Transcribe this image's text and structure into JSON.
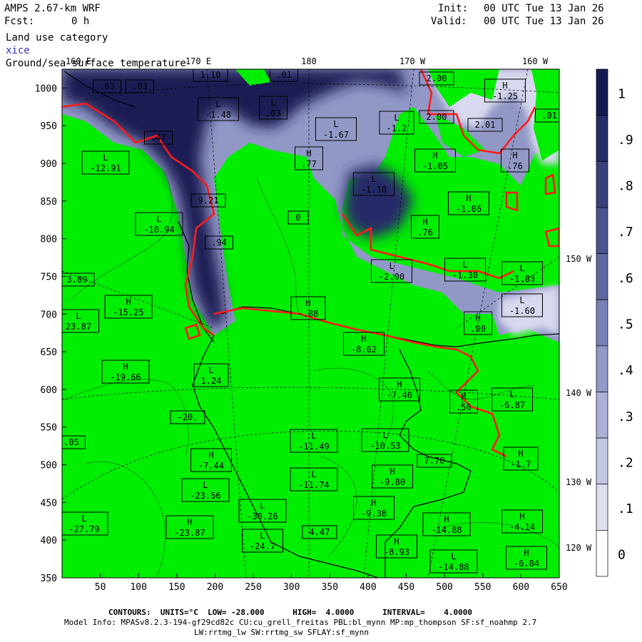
{
  "header": {
    "model_title": "AMPS 2.67-km WRF",
    "forecast_label": "Fcst:",
    "forecast_hour": "0 h",
    "init_label": "Init:",
    "init_time": "00 UTC Tue 13 Jan 26",
    "valid_label": "Valid:",
    "valid_time": "00 UTC Tue 13 Jan 26",
    "field_1": "Land use category",
    "field_2": "xice",
    "field_3": "Ground/sea surface temperature"
  },
  "map": {
    "x_ticks": [
      "50",
      "100",
      "150",
      "200",
      "250",
      "300",
      "350",
      "400",
      "450",
      "500",
      "550",
      "600",
      "650"
    ],
    "y_ticks": [
      "1000",
      "950",
      "900",
      "850",
      "800",
      "750",
      "700",
      "650",
      "600",
      "550",
      "500",
      "450",
      "400",
      "350"
    ],
    "lon_labels_top": [
      "160 E",
      "170 E",
      "180",
      "170 W",
      "160 W"
    ],
    "lon_labels_right": [
      "150 W",
      "140 W",
      "130 W",
      "120 W"
    ],
    "colors": {
      "land": "#00ee00",
      "ice_dark": "#1a1f55",
      "ice_light": "#d8d8ee",
      "coast": "#000000",
      "ice_edge": "#ff0000"
    }
  },
  "temperature_labels": [
    {
      "t": "",
      "v": ".03"
    },
    {
      "t": "",
      "v": ".03"
    },
    {
      "t": "",
      "v": "1.10"
    },
    {
      "t": "",
      "v": ".01"
    },
    {
      "t": "",
      "v": "2.00"
    },
    {
      "t": "H",
      "v": "-1.25"
    },
    {
      "t": "",
      "v": ".01"
    },
    {
      "t": "L",
      "v": "-1.48"
    },
    {
      "t": "L",
      "v": ".03"
    },
    {
      "t": "L",
      "v": "-1.67"
    },
    {
      "t": "L",
      "v": "-1.2"
    },
    {
      "t": "",
      "v": "2.00"
    },
    {
      "t": "",
      "v": "2.01"
    },
    {
      "t": "",
      "v": ".47"
    },
    {
      "t": "L",
      "v": "-12.91"
    },
    {
      "t": "H",
      "v": ".77"
    },
    {
      "t": "H",
      "v": "-1.05"
    },
    {
      "t": "H",
      "v": ".76"
    },
    {
      "t": "L",
      "v": "-1.10"
    },
    {
      "t": "H",
      "v": "-1.06"
    },
    {
      "t": "",
      "v": "9.21"
    },
    {
      "t": "L",
      "v": "-18.94"
    },
    {
      "t": "",
      "v": ".94"
    },
    {
      "t": "",
      "v": "0"
    },
    {
      "t": "H",
      "v": ".76"
    },
    {
      "t": "L",
      "v": "-1.30"
    },
    {
      "t": "L",
      "v": "-1.83"
    },
    {
      "t": "L",
      "v": "-2.00"
    },
    {
      "t": "",
      "v": "3.89"
    },
    {
      "t": "H",
      "v": "-15.25"
    },
    {
      "t": "H",
      "v": "-.88"
    },
    {
      "t": "L",
      "v": "-1.60"
    },
    {
      "t": "L",
      "v": "23.87"
    },
    {
      "t": "H",
      "v": "-8.62"
    },
    {
      "t": "H",
      "v": ".90"
    },
    {
      "t": "H",
      "v": "-19.66"
    },
    {
      "t": "L",
      "v": "1.24"
    },
    {
      "t": "H",
      "v": "-7.40"
    },
    {
      "t": "H",
      "v": ".56"
    },
    {
      "t": "L",
      "v": "-6.87"
    },
    {
      "t": "",
      "v": "-20."
    },
    {
      "t": "",
      "v": ".05"
    },
    {
      "t": "L",
      "v": "-11.49"
    },
    {
      "t": "L",
      "v": "-10.53"
    },
    {
      "t": "H",
      "v": "-7.44"
    },
    {
      "t": "L",
      "v": "-11.74"
    },
    {
      "t": "H",
      "v": "-9.80"
    },
    {
      "t": "",
      "v": "7.70"
    },
    {
      "t": "H",
      "v": "-1.7"
    },
    {
      "t": "L",
      "v": "-23.56"
    },
    {
      "t": "L",
      "v": "-30.26"
    },
    {
      "t": "H",
      "v": "-9.38"
    },
    {
      "t": "L",
      "v": "-27.79"
    },
    {
      "t": "H",
      "v": "-23.87"
    },
    {
      "t": "L",
      "v": "-24.7"
    },
    {
      "t": "",
      "v": "4.47"
    },
    {
      "t": "H",
      "v": "-14.88"
    },
    {
      "t": "H",
      "v": "-4.14"
    },
    {
      "t": "H",
      "v": "-8.93"
    },
    {
      "t": "L",
      "v": "-14.88"
    },
    {
      "t": "H",
      "v": "-6.04"
    }
  ],
  "colorbar": {
    "levels": [
      "1",
      ".9",
      ".8",
      ".7",
      ".6",
      ".5",
      ".4",
      ".3",
      ".2",
      ".1",
      "0"
    ],
    "colors": [
      "#141a52",
      "#262c68",
      "#38407c",
      "#4c5490",
      "#6068a2",
      "#7880b4",
      "#9298c6",
      "#aab0d6",
      "#c4c8e4",
      "#dcdff0",
      "#ffffff"
    ]
  },
  "footer": {
    "contours": "CONTOURS:  UNITS=°C  LOW= -28.000      HIGH=  4.0000      INTERVAL=    4.0000",
    "model_info": "Model Info: MPASv8.2.3-194-gf29cd82c CU:cu_grell_freitas PBL:bl_mynn MP:mp_thompson SF:sf_noahmp 2.7",
    "schemes": "LW:rrtmg_lw SW:rrtmg_sw SFLAY:sf_mynn"
  }
}
